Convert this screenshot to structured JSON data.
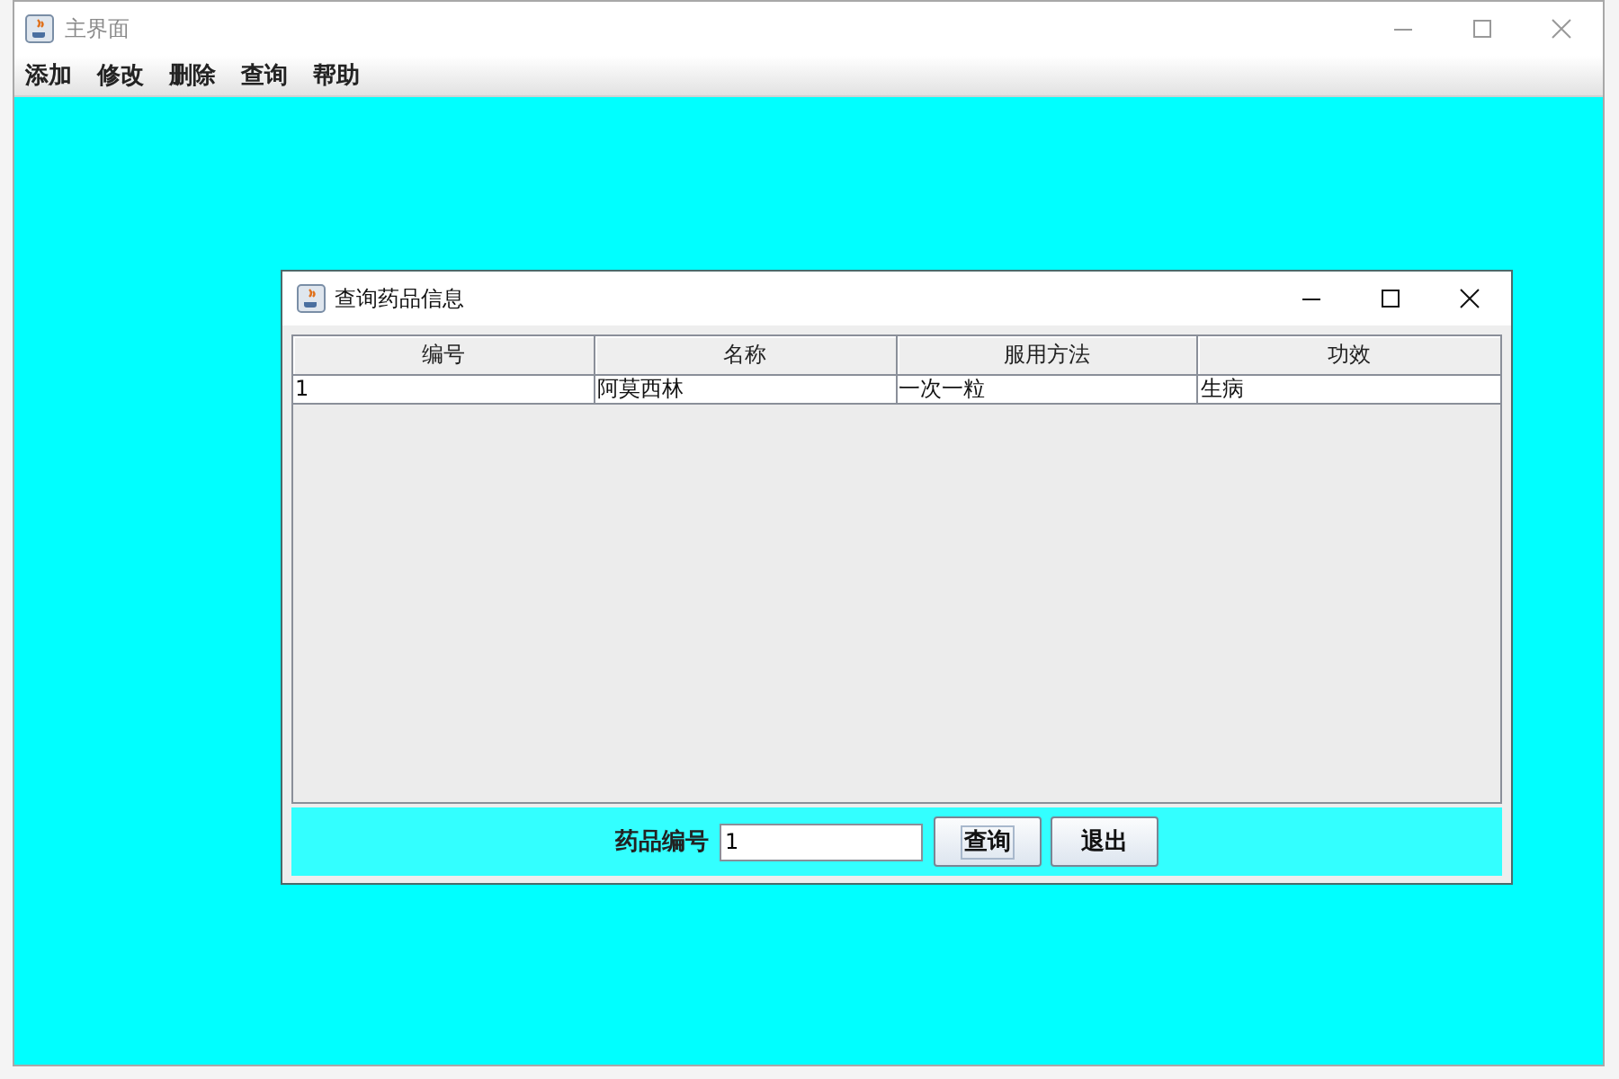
{
  "main_window": {
    "title": "主界面",
    "menu": [
      "添加",
      "修改",
      "删除",
      "查询",
      "帮助"
    ]
  },
  "dialog": {
    "title": "查询药品信息",
    "table": {
      "columns": [
        "编号",
        "名称",
        "服用方法",
        "功效"
      ],
      "rows": [
        [
          "1",
          "阿莫西林",
          "一次一粒",
          "生病"
        ]
      ]
    },
    "form": {
      "label": "药品编号",
      "value": "1",
      "buttons": [
        {
          "label": "查询",
          "focused": true
        },
        {
          "label": "退出",
          "focused": false
        }
      ]
    }
  }
}
